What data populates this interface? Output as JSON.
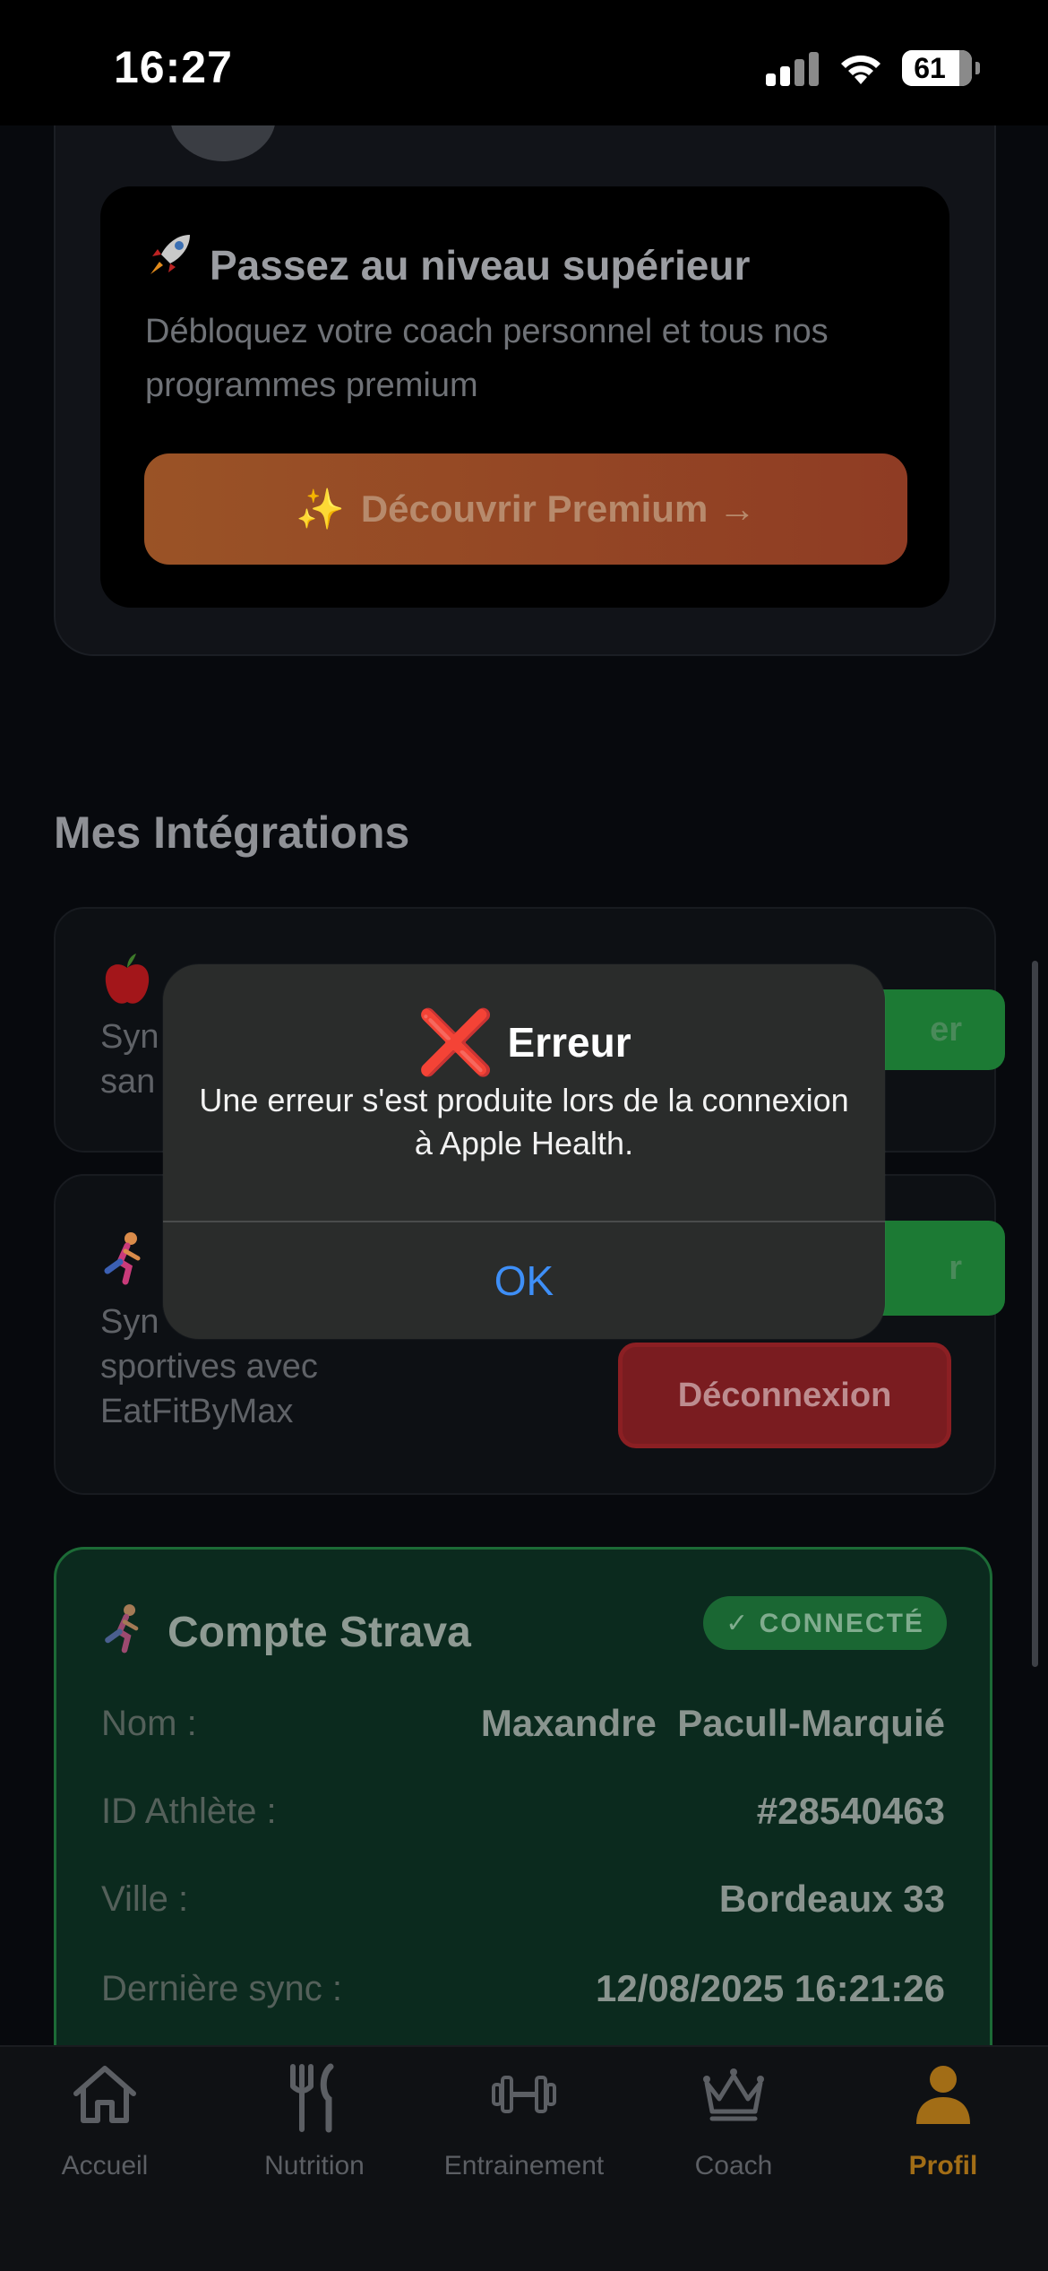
{
  "status_bar": {
    "time": "16:27",
    "battery": "61"
  },
  "premium": {
    "title": "Passez au niveau supérieur",
    "title_emoji": "rocket",
    "description": "Débloquez votre coach personnel et tous nos programmes premium",
    "button_label": "Découvrir Premium →",
    "button_emoji": "✨"
  },
  "integrations": {
    "section_title": "Mes Intégrations",
    "apple_health": {
      "icon": "apple-icon",
      "desc_line1": "Syn",
      "desc_line2": "san",
      "button_label": "er"
    },
    "strava": {
      "icon": "runner-icon",
      "desc_line1": "Syn",
      "desc_line2": "sportives avec",
      "desc_line3": "EatFitByMax",
      "button_label": "r",
      "disconnect_label": "Déconnexion"
    }
  },
  "strava_account": {
    "title": "Compte Strava",
    "badge": "✓ CONNECTÉ",
    "rows": [
      {
        "label": "Nom :",
        "value": "Maxandre  Pacull-Marquié"
      },
      {
        "label": "ID Athlète :",
        "value": "#28540463"
      },
      {
        "label": "Ville :",
        "value": "Bordeaux 33"
      },
      {
        "label": "Dernière sync :",
        "value": "12/08/2025 16:21:26"
      }
    ]
  },
  "dialog": {
    "title": "Erreur",
    "title_icon": "❌",
    "message": "Une erreur s'est produite lors de la connexion à Apple Health.",
    "ok_label": "OK"
  },
  "tabs": [
    {
      "label": "Accueil",
      "icon": "home-icon"
    },
    {
      "label": "Nutrition",
      "icon": "fork-knife-icon"
    },
    {
      "label": "Entrainement",
      "icon": "dumbbell-icon"
    },
    {
      "label": "Coach",
      "icon": "crown-icon"
    },
    {
      "label": "Profil",
      "icon": "person-icon",
      "active": true
    }
  ],
  "colors": {
    "accent": "#a26d16",
    "danger": "#e0251c",
    "success": "#1c7a34",
    "link": "#3e8ff7"
  }
}
